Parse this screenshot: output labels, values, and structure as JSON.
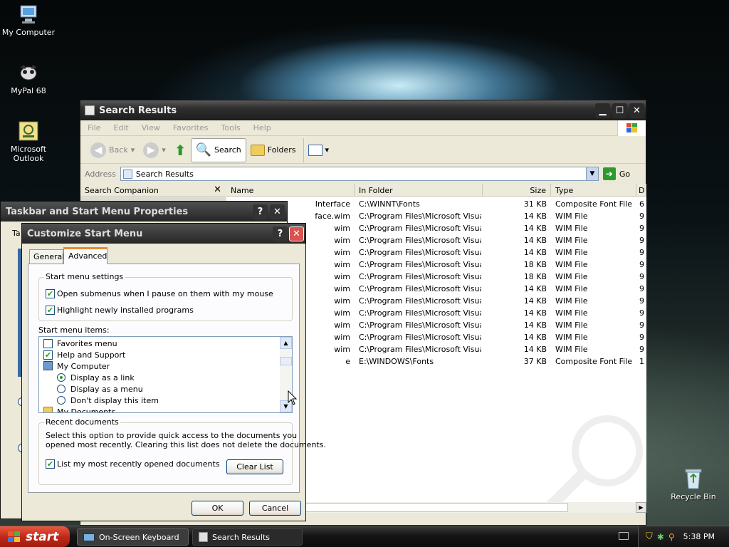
{
  "desktop": {
    "icons": [
      {
        "label": "My Computer",
        "icon": "my-computer-icon"
      },
      {
        "label": "MyPal 68",
        "icon": "mypal-icon"
      },
      {
        "label": "Microsoft Outlook",
        "icon": "outlook-icon"
      },
      {
        "label": "Recycle Bin",
        "icon": "recycle-bin-icon"
      }
    ]
  },
  "search_window": {
    "title": "Search Results",
    "menu": [
      "File",
      "Edit",
      "View",
      "Favorites",
      "Tools",
      "Help"
    ],
    "toolbar": {
      "back": "Back",
      "search": "Search",
      "folders": "Folders"
    },
    "address": {
      "label": "Address",
      "value": "Search Results",
      "go": "Go"
    },
    "companion": "Search Companion",
    "columns": [
      "Name",
      "In Folder",
      "Size",
      "Type",
      "D"
    ],
    "rows": [
      {
        "name": "Interface",
        "folder": "C:\\WINNT\\Fonts",
        "size": "31 KB",
        "type": "Composite Font File",
        "d": "6"
      },
      {
        "name": "face.wim",
        "folder": "C:\\Program Files\\Microsoft Visua...",
        "size": "14 KB",
        "type": "WIM File",
        "d": "9"
      },
      {
        "name": "wim",
        "folder": "C:\\Program Files\\Microsoft Visua...",
        "size": "14 KB",
        "type": "WIM File",
        "d": "9"
      },
      {
        "name": "wim",
        "folder": "C:\\Program Files\\Microsoft Visua...",
        "size": "14 KB",
        "type": "WIM File",
        "d": "9"
      },
      {
        "name": "wim",
        "folder": "C:\\Program Files\\Microsoft Visua...",
        "size": "14 KB",
        "type": "WIM File",
        "d": "9"
      },
      {
        "name": "wim",
        "folder": "C:\\Program Files\\Microsoft Visua...",
        "size": "18 KB",
        "type": "WIM File",
        "d": "9"
      },
      {
        "name": "wim",
        "folder": "C:\\Program Files\\Microsoft Visua...",
        "size": "18 KB",
        "type": "WIM File",
        "d": "9"
      },
      {
        "name": "wim",
        "folder": "C:\\Program Files\\Microsoft Visua...",
        "size": "14 KB",
        "type": "WIM File",
        "d": "9"
      },
      {
        "name": "wim",
        "folder": "C:\\Program Files\\Microsoft Visua...",
        "size": "14 KB",
        "type": "WIM File",
        "d": "9"
      },
      {
        "name": "wim",
        "folder": "C:\\Program Files\\Microsoft Visua...",
        "size": "14 KB",
        "type": "WIM File",
        "d": "9"
      },
      {
        "name": "wim",
        "folder": "C:\\Program Files\\Microsoft Visua...",
        "size": "14 KB",
        "type": "WIM File",
        "d": "9"
      },
      {
        "name": "wim",
        "folder": "C:\\Program Files\\Microsoft Visua...",
        "size": "14 KB",
        "type": "WIM File",
        "d": "9"
      },
      {
        "name": "wim",
        "folder": "C:\\Program Files\\Microsoft Visua...",
        "size": "14 KB",
        "type": "WIM File",
        "d": "9"
      },
      {
        "name": "e",
        "folder": "E:\\WINDOWS\\Fonts",
        "size": "37 KB",
        "type": "Composite Font File",
        "d": "1"
      }
    ]
  },
  "taskbar_props": {
    "title": "Taskbar and Start Menu Properties",
    "tab_stub": "Ta"
  },
  "customize": {
    "title": "Customize Start Menu",
    "tabs": [
      "General",
      "Advanced"
    ],
    "settings_group": "Start menu settings",
    "opt1": "Open submenus when I pause on them with my mouse",
    "opt2": "Highlight newly installed programs",
    "items_label": "Start menu items:",
    "items": {
      "favorites": "Favorites menu",
      "help": "Help and Support",
      "mycomputer": "My Computer",
      "link": "Display as a link",
      "menu": "Display as a menu",
      "none": "Don't display this item",
      "mydocs": "My Documents"
    },
    "recent_group": "Recent documents",
    "recent_desc1": "Select this option to provide quick access to the documents you",
    "recent_desc2": "opened most recently.  Clearing this list does not delete the documents.",
    "recent_chk": "List my most recently opened documents",
    "clear": "Clear List",
    "ok": "OK",
    "cancel": "Cancel"
  },
  "taskbar": {
    "start": "start",
    "tasks": [
      "On-Screen Keyboard",
      "Search Results"
    ],
    "clock": "5:38 PM"
  }
}
